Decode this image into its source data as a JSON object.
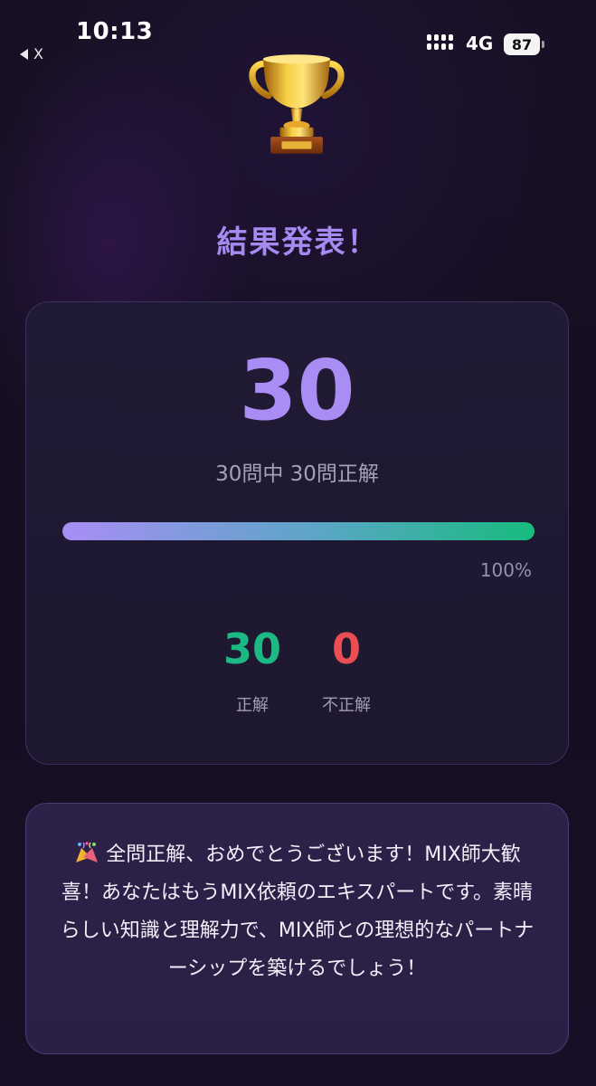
{
  "status_bar": {
    "time": "10:13",
    "back_label": "X",
    "network": "4G",
    "battery": "87"
  },
  "header": {
    "trophy_icon": "trophy-icon",
    "title": "結果発表！"
  },
  "score_card": {
    "score": "30",
    "summary": "30問中 30問正解",
    "progress_fraction": 1.0,
    "percent_label": "100%",
    "correct_value": "30",
    "correct_label": "正解",
    "wrong_value": "0",
    "wrong_label": "不正解"
  },
  "message": {
    "icon": "party-popper-icon",
    "text": "全問正解、おめでとうございます！MIX師大歓喜！あなたはもうMIX依頼のエキスパートです。素晴らしい知識と理解力で、MIX師との理想的なパートナーシップを築けるでしょう！"
  },
  "colors": {
    "accent_purple": "#a98cf4",
    "correct_green": "#1db985",
    "wrong_red": "#ea4d52"
  }
}
